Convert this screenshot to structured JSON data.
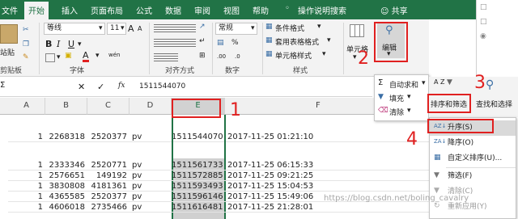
{
  "menubar": {
    "tabs": [
      "文件",
      "开始",
      "插入",
      "页面布局",
      "公式",
      "数据",
      "审阅",
      "视图",
      "帮助"
    ],
    "tell_me": "操作说明搜索",
    "share": "共享"
  },
  "ribbon": {
    "clipboard": {
      "paste_label": "站贴",
      "group": "剪贴板"
    },
    "font": {
      "name": "等线",
      "size": "11",
      "bold": "B",
      "italic": "I",
      "underline": "U",
      "group": "字体",
      "grow": "A",
      "shrink": "A",
      "font_color": "A",
      "wen": "wén"
    },
    "alignment": {
      "group": "对齐方式"
    },
    "number": {
      "format": "常规",
      "percent": "%",
      "group": "数字"
    },
    "styles": {
      "conditional": "条件格式",
      "table": "套用表格格式",
      "cell_styles": "单元格样式",
      "group": "样式"
    },
    "cells": {
      "label": "单元格"
    },
    "editing": {
      "label": "编辑"
    }
  },
  "dropdown": {
    "autosum": "自动求和",
    "fill": "填充",
    "clear": "清除"
  },
  "sort_buttons": {
    "sort_filter": "排序和筛选",
    "find_select": "查找和选择",
    "az": "A Z"
  },
  "sort_menu": {
    "items": [
      "升序(S)",
      "降序(O)",
      "自定义排序(U)...",
      "筛选(F)",
      "清除(C)",
      "重新应用(Y)"
    ]
  },
  "formula_bar": {
    "fx": "fx",
    "value": "1511544070",
    "sigma": "Σ"
  },
  "grid": {
    "columns": [
      "A",
      "B",
      "C",
      "D",
      "E",
      "F"
    ],
    "top_row": {
      "a": "1",
      "b": "2268318",
      "c": "2520377",
      "d": "pv",
      "e": "1511544070",
      "f": "2017-11-25 01:21:10"
    },
    "rows": [
      {
        "a": "1",
        "b": "2333346",
        "c": "2520771",
        "d": "pv",
        "e": "1511561733",
        "f": "2017-11-25 06:15:33"
      },
      {
        "a": "1",
        "b": "2576651",
        "c": "149192",
        "d": "pv",
        "e": "1511572885",
        "f": "2017-11-25 09:21:25"
      },
      {
        "a": "1",
        "b": "3830808",
        "c": "4181361",
        "d": "pv",
        "e": "1511593493",
        "f": "2017-11-25 15:04:53"
      },
      {
        "a": "1",
        "b": "4365585",
        "c": "2520377",
        "d": "pv",
        "e": "1511596146",
        "f": "2017-11-25 15:49:06"
      },
      {
        "a": "1",
        "b": "4606018",
        "c": "2735466",
        "d": "pv",
        "e": "1511616481",
        "f": "2017-11-25 21:28:01"
      }
    ]
  },
  "annotations": {
    "n1": "1",
    "n2": "2",
    "n3": "3",
    "n4": "4"
  },
  "watermark": "https://blog.csdn.net/boling_cavalry",
  "colors": {
    "excel_green": "#217346",
    "annotation_red": "#e02020",
    "selection_gray": "#d0d0d0"
  }
}
